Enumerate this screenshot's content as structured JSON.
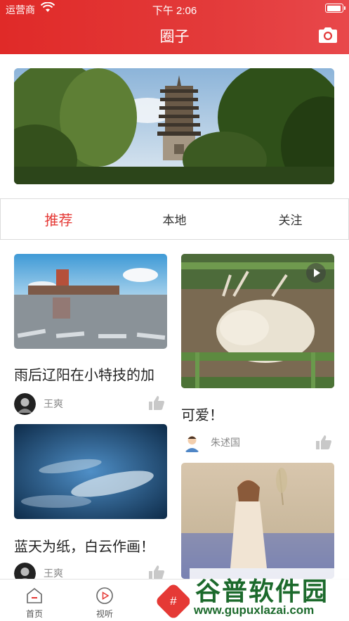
{
  "status_bar": {
    "carrier": "运营商",
    "time": "下午 2:06",
    "battery_level": 0.95
  },
  "header": {
    "title": "圈子",
    "camera_icon": "camera-icon"
  },
  "tabs": [
    {
      "label": "推荐",
      "active": true
    },
    {
      "label": "本地",
      "active": false
    },
    {
      "label": "关注",
      "active": false
    }
  ],
  "feed": {
    "left": [
      {
        "title": "雨后辽阳在小特技的加",
        "author": "王爽",
        "image": "rainy-plaza-photo"
      },
      {
        "title": "蓝天为纸，白云作画！",
        "author": "王爽",
        "image": "blue-sky-clouds-photo"
      }
    ],
    "right": [
      {
        "title": "可爱！",
        "author": "朱述国",
        "image": "deer-photo",
        "is_video": true
      },
      {
        "title": "",
        "author": "",
        "image": "girl-flower-field-photo"
      }
    ]
  },
  "bottom_nav": {
    "items": [
      {
        "label": "首页",
        "icon": "home-icon"
      },
      {
        "label": "视听",
        "icon": "play-circle-icon"
      }
    ],
    "center_label": "#"
  },
  "watermark": {
    "title": "谷普软件园",
    "url": "www.gupuxlazai.com"
  },
  "colors": {
    "accent": "#e53935",
    "header_start": "#e02a28",
    "header_end": "#e8484b"
  }
}
